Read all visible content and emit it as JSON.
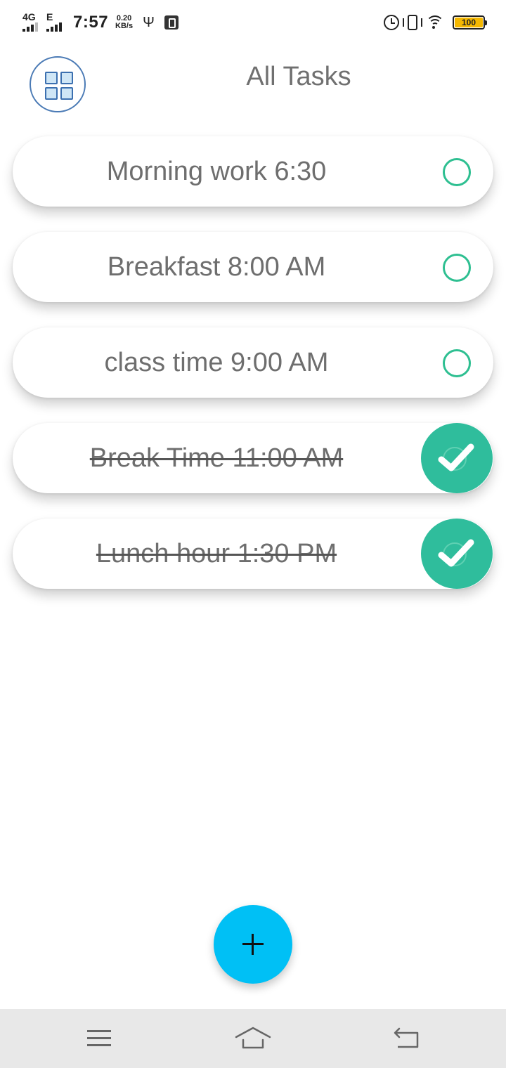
{
  "status_bar": {
    "network1": "4G",
    "network2": "E",
    "time": "7:57",
    "speed_value": "0.20",
    "speed_unit": "KB/s",
    "battery": "100",
    "icons": [
      "usb-icon",
      "usb-settings-icon",
      "alarm-icon",
      "vibrate-icon",
      "wifi-icon",
      "battery-icon"
    ]
  },
  "header": {
    "menu_icon": "grid-icon",
    "title": "All Tasks"
  },
  "tasks": [
    {
      "text": "Morning work 6:30",
      "done": false
    },
    {
      "text": "Breakfast 8:00 AM",
      "done": false
    },
    {
      "text": "class time 9:00 AM",
      "done": false
    },
    {
      "text": "Break Time 11:00 AM",
      "done": true
    },
    {
      "text": "Lunch hour 1:30 PM",
      "done": true
    }
  ],
  "fab": {
    "icon": "plus-icon"
  },
  "nav_bar": {
    "icons": [
      "menu-icon",
      "home-icon",
      "back-icon"
    ]
  },
  "colors": {
    "accent_green": "#2fbd9c",
    "fab_blue": "#00c0f5",
    "menu_blue": "#3c70b0",
    "battery_yellow": "#f5b800"
  }
}
